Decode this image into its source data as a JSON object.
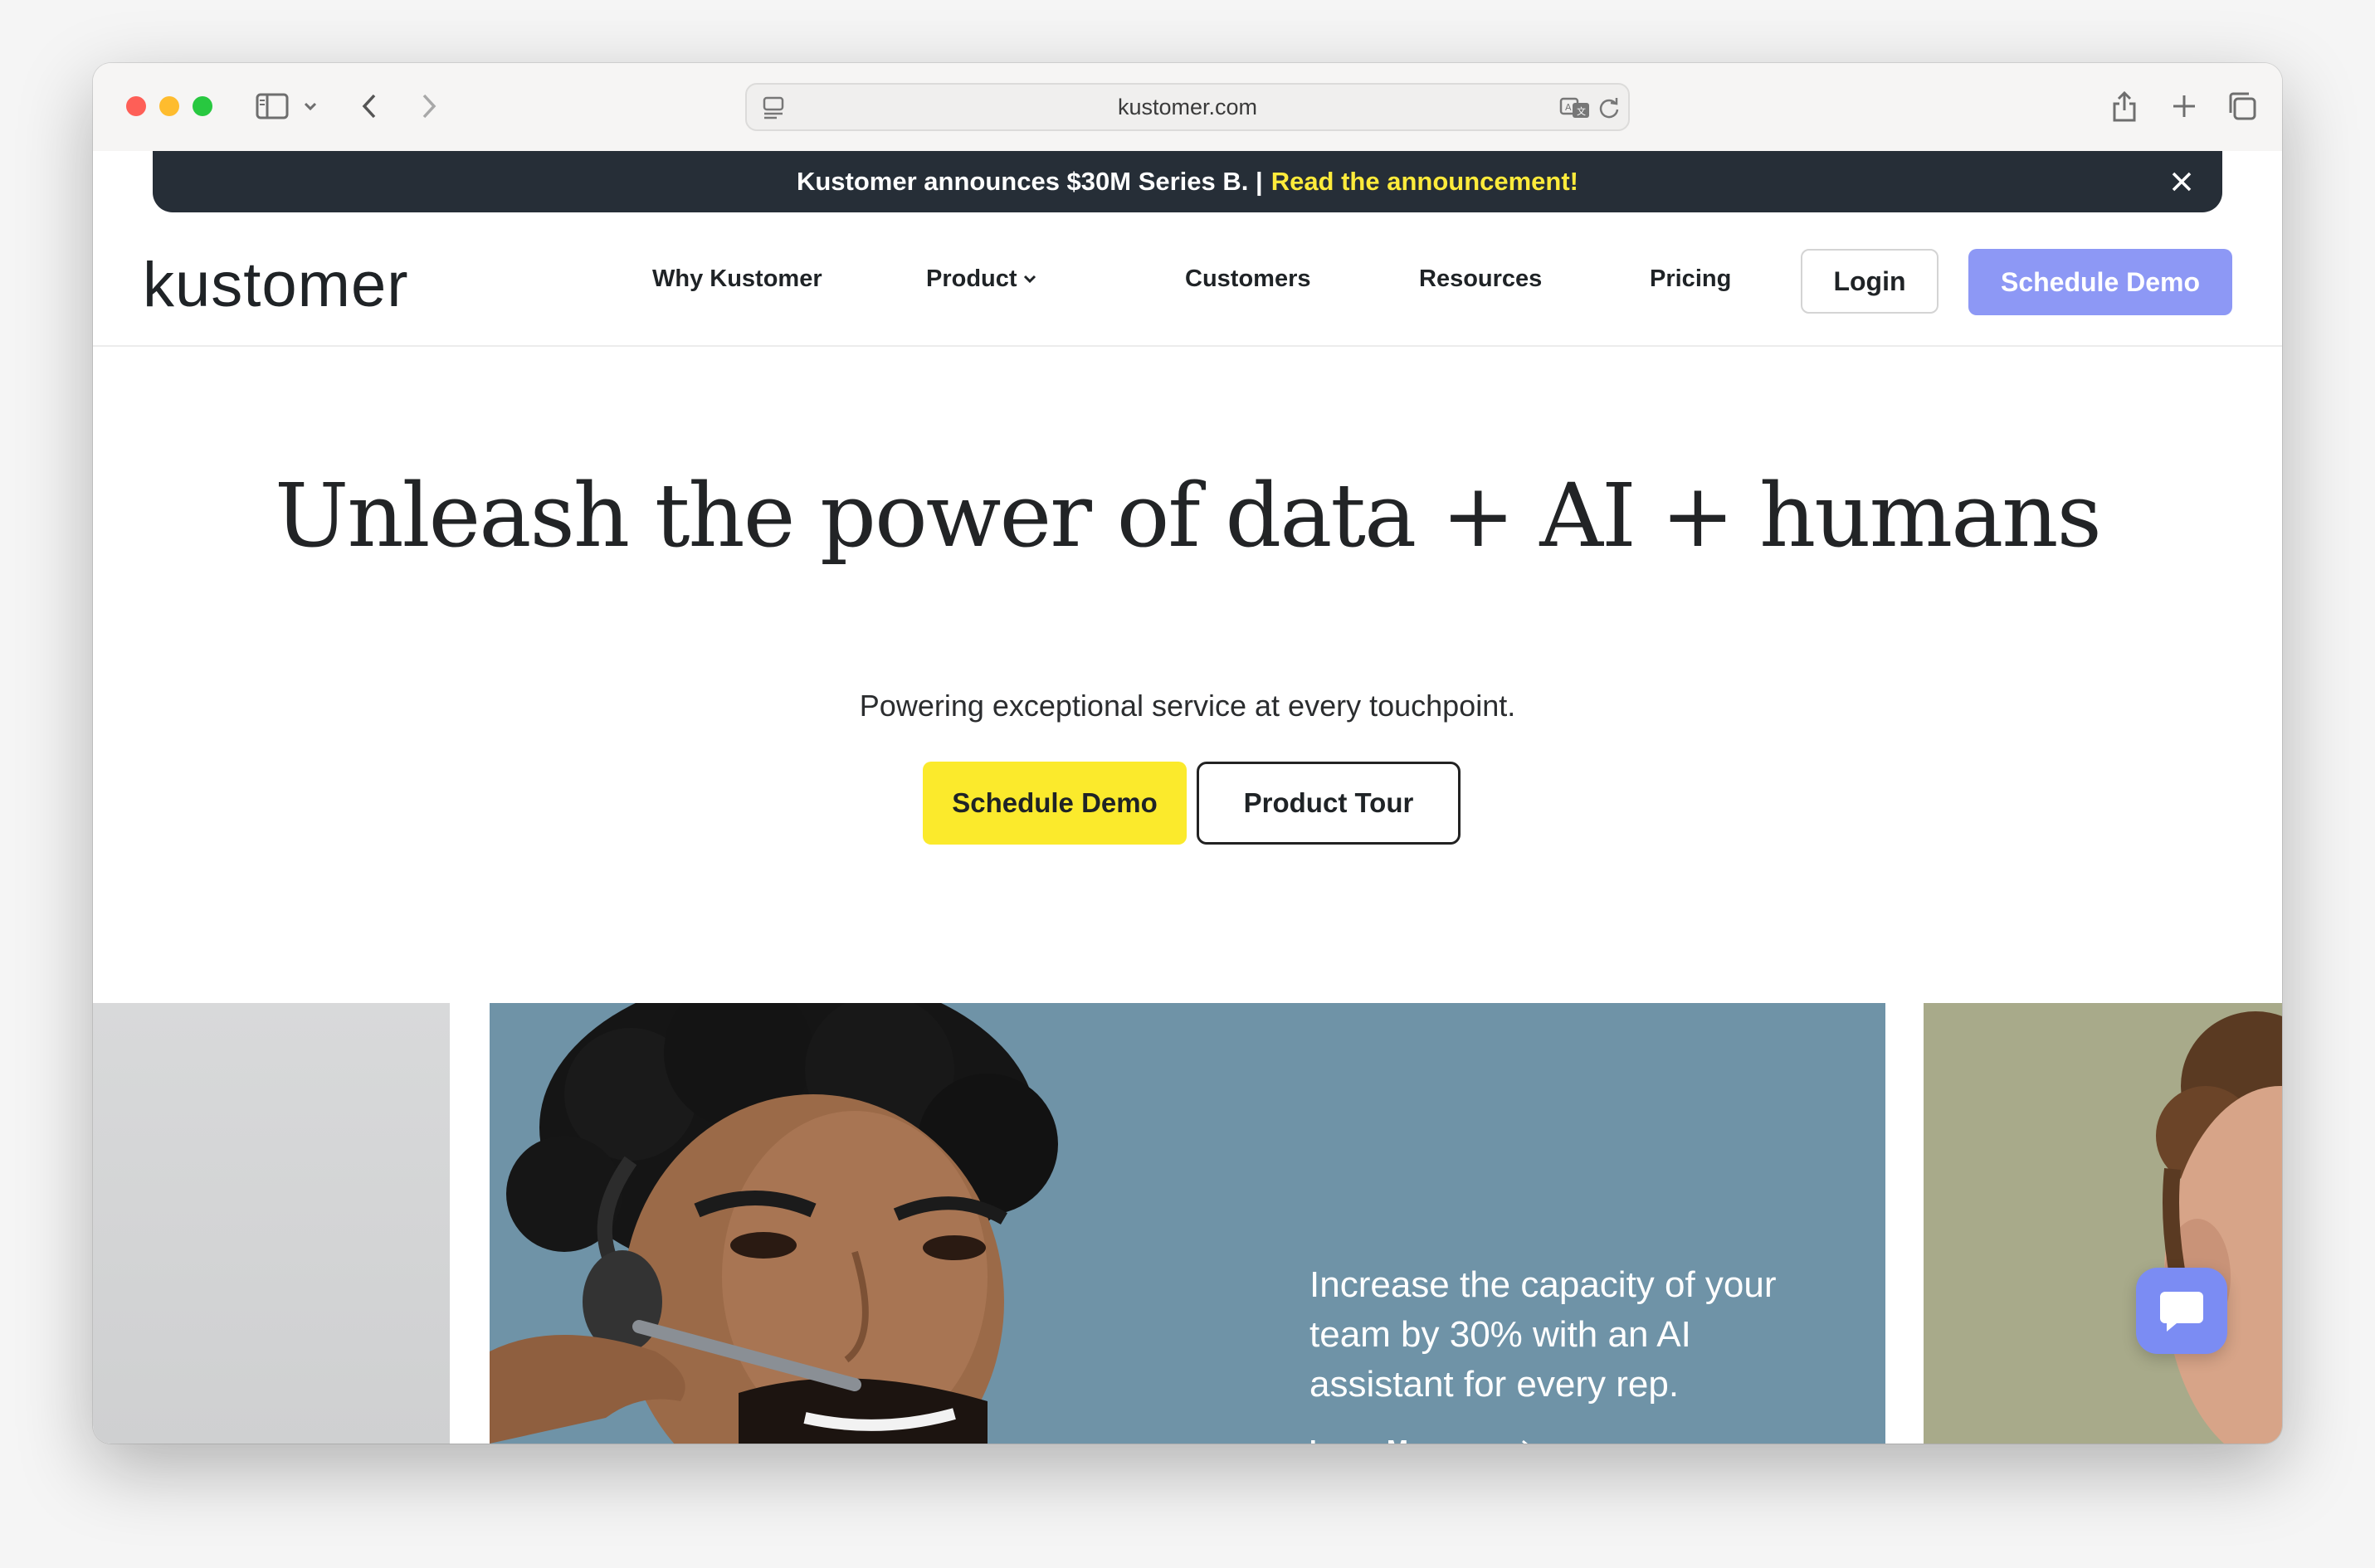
{
  "browser": {
    "url": "kustomer.com",
    "icons": [
      "sidebar-icon",
      "chevron-down-icon",
      "back-icon",
      "forward-icon",
      "page-icon",
      "translate-icon",
      "reload-icon",
      "share-icon",
      "new-tab-icon",
      "tabs-overview-icon"
    ]
  },
  "announcement": {
    "text": "Kustomer announces $30M Series B. |",
    "link": "Read the announcement!",
    "close_icon": "close-icon"
  },
  "nav": {
    "logo": "kustomer",
    "items": [
      "Why Kustomer",
      "Product",
      "Customers",
      "Resources",
      "Pricing"
    ],
    "login": "Login",
    "demo": "Schedule Demo"
  },
  "hero": {
    "title": "Unleash the power of data + AI + humans",
    "subtitle": "Powering exceptional service at every touchpoint.",
    "primary_button": "Schedule Demo",
    "secondary_button": "Product Tour"
  },
  "carousel": {
    "slide_text": "Increase the capacity of your team by 30% with an AI assistant for every rep.",
    "learn_more": "Learn More"
  },
  "colors": {
    "announce_bg": "#262e37",
    "announce_link": "#ffeb3b",
    "nav_demo": "#8d98f5",
    "hero_demo": "#fbea2c",
    "slide_bg": "#6f93a7",
    "chat": "#7b8cf3"
  }
}
